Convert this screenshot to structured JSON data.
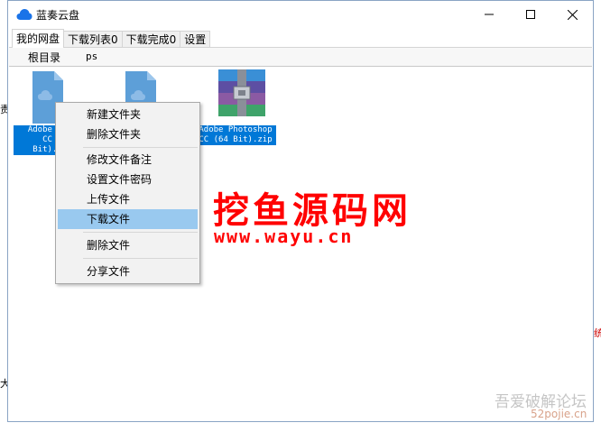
{
  "window": {
    "title": "蓝奏云盘",
    "minimize_icon": "minimize-icon",
    "maximize_icon": "maximize-icon",
    "close_icon": "close-icon"
  },
  "tabs": [
    {
      "label": "我的网盘",
      "active": true
    },
    {
      "label": "下载列表0"
    },
    {
      "label": "下载完成0"
    },
    {
      "label": "设置"
    }
  ],
  "breadcrumb": {
    "root": "根目录",
    "current": "ps"
  },
  "files": [
    {
      "name": "Adobe Ph\nCC\nBit).z",
      "icon": "cloud-file-icon"
    },
    {
      "name": "",
      "icon": "cloud-file-icon"
    },
    {
      "name": "Adobe Photoshop\nCC (64 Bit).zip",
      "icon": "archive-icon"
    }
  ],
  "context_menu": {
    "items": [
      {
        "label": "新建文件夹"
      },
      {
        "label": "删除文件夹"
      },
      {
        "label": "修改文件备注"
      },
      {
        "label": "设置文件密码"
      },
      {
        "label": "上传文件"
      },
      {
        "label": "下载文件",
        "highlighted": true
      },
      {
        "label": "删除文件"
      },
      {
        "label": "分享文件"
      }
    ]
  },
  "watermark": {
    "title": "挖鱼源码网",
    "url": "www.wayu.cn",
    "forum": "吾爱破解论坛",
    "forum_url": "52pojie.cn"
  },
  "background_fragments": {
    "left_mid": "责",
    "left_low": "大",
    "right_mid": "统"
  },
  "colors": {
    "accent": "#0078d7",
    "menu_highlight": "#99c9ef",
    "watermark": "#ff0000",
    "cloud": "#1a73e8"
  }
}
